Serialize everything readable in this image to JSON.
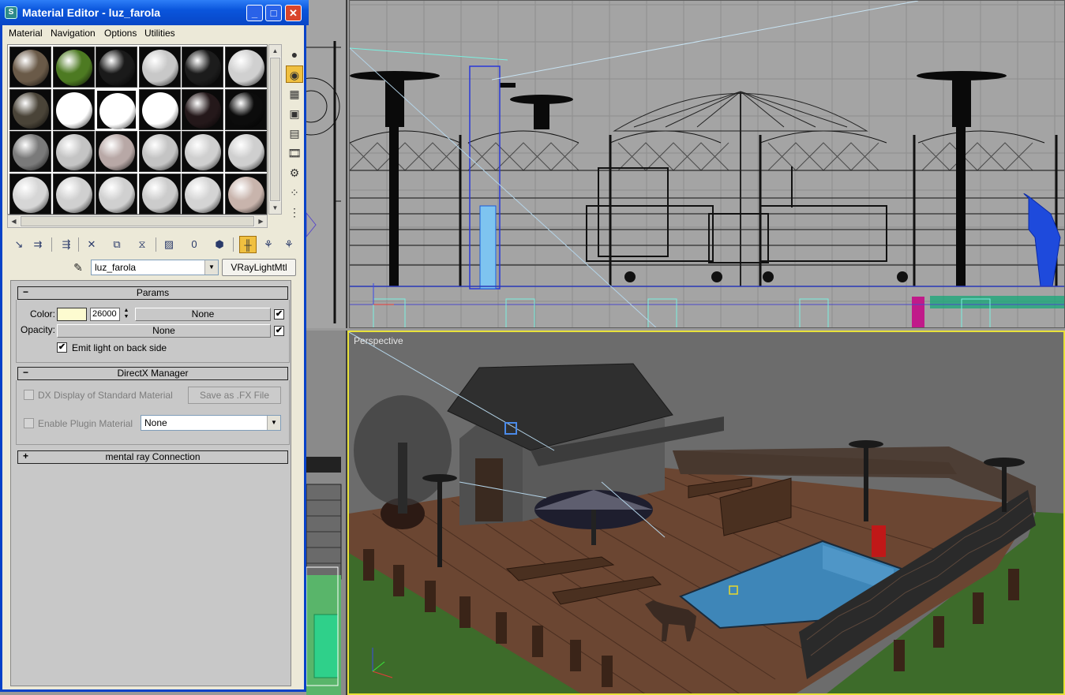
{
  "window": {
    "title": "Material Editor - luz_farola",
    "app_icon": "3ds-max-icon",
    "minimize": "_",
    "maximize": "□",
    "close": "✕"
  },
  "menu": [
    "Material",
    "Navigation",
    "Options",
    "Utilities"
  ],
  "sample_slots": [
    {
      "name": "slot-1",
      "color": "#6a5a48",
      "active": false
    },
    {
      "name": "slot-2",
      "color": "#4d7a22",
      "active": false
    },
    {
      "name": "slot-3",
      "color": "#1a1a1a",
      "active": false
    },
    {
      "name": "slot-4",
      "color": "#c8c8c8",
      "active": false
    },
    {
      "name": "slot-5",
      "color": "#1c1c1c",
      "active": false
    },
    {
      "name": "slot-6",
      "color": "#d0d0d0",
      "active": false
    },
    {
      "name": "slot-7",
      "color": "#4a4438",
      "active": false
    },
    {
      "name": "slot-8",
      "color": "#ffffff",
      "active": false
    },
    {
      "name": "slot-9",
      "color": "#ffffff",
      "active": true
    },
    {
      "name": "slot-10",
      "color": "#ffffff",
      "active": false
    },
    {
      "name": "slot-11",
      "color": "#24181a",
      "active": false
    },
    {
      "name": "slot-12",
      "color": "#0c0c0c",
      "active": false
    },
    {
      "name": "slot-13",
      "color": "#7a7a7a",
      "active": false
    },
    {
      "name": "slot-14",
      "color": "#c4c4c4",
      "active": false
    },
    {
      "name": "slot-15",
      "color": "#b8a8a6",
      "active": false
    },
    {
      "name": "slot-16",
      "color": "#c4c4c4",
      "active": false
    },
    {
      "name": "slot-17",
      "color": "#cfcfcf",
      "active": false
    },
    {
      "name": "slot-18",
      "color": "#cfcfcf",
      "active": false
    },
    {
      "name": "slot-19",
      "color": "#d6d6d6",
      "active": false
    },
    {
      "name": "slot-20",
      "color": "#d0d0d0",
      "active": false
    },
    {
      "name": "slot-21",
      "color": "#d0d0d0",
      "active": false
    },
    {
      "name": "slot-22",
      "color": "#cccccc",
      "active": false
    },
    {
      "name": "slot-23",
      "color": "#d4d4d4",
      "active": false
    },
    {
      "name": "slot-24",
      "color": "#c8b4ac",
      "active": false
    }
  ],
  "side_tools": [
    {
      "name": "sample-type-icon",
      "glyph": "●",
      "active": false
    },
    {
      "name": "backlight-icon",
      "glyph": "◉",
      "active": true
    },
    {
      "name": "background-checker-icon",
      "glyph": "▦",
      "active": false
    },
    {
      "name": "sample-uv-tiling-icon",
      "glyph": "▣",
      "active": false
    },
    {
      "name": "video-color-check-icon",
      "glyph": "▤",
      "active": false
    },
    {
      "name": "make-preview-icon",
      "glyph": "🎞",
      "active": false
    },
    {
      "name": "options-icon",
      "glyph": "⚙",
      "active": false
    },
    {
      "name": "select-by-material-icon",
      "glyph": "⁘",
      "active": false
    },
    {
      "name": "material-map-navigator-icon",
      "glyph": "⋮",
      "active": false
    }
  ],
  "bottom_tools": [
    {
      "name": "get-material-icon",
      "glyph": "↘",
      "active": false
    },
    {
      "name": "put-to-scene-icon",
      "glyph": "⇉",
      "active": false
    },
    {
      "name": "assign-to-selection-icon",
      "glyph": "⇶",
      "active": false
    },
    {
      "name": "reset-map-icon",
      "glyph": "✕",
      "active": false
    },
    {
      "name": "make-copy-icon",
      "glyph": "⧉",
      "active": false
    },
    {
      "name": "make-unique-icon",
      "glyph": "⧖",
      "active": false
    },
    {
      "name": "put-to-library-icon",
      "glyph": "▨",
      "active": false
    },
    {
      "name": "material-effects-channel-icon",
      "glyph": "0",
      "active": false
    },
    {
      "name": "show-map-in-viewport-icon",
      "glyph": "⬢",
      "active": false
    },
    {
      "name": "show-end-result-icon",
      "glyph": "╫",
      "active": true
    },
    {
      "name": "go-to-parent-icon",
      "glyph": "⚘",
      "active": false
    },
    {
      "name": "go-forward-to-sibling-icon",
      "glyph": "⚘",
      "active": false
    }
  ],
  "material": {
    "name": "luz_farola",
    "type": "VRayLightMtl",
    "picker_icon": "eyedropper-icon"
  },
  "params": {
    "header": "Params",
    "sign": "−",
    "color_label": "Color:",
    "color_value": "#fdfbd0",
    "intensity": "26000",
    "color_map": "None",
    "color_map_enabled": "✔",
    "opacity_label": "Opacity:",
    "opacity_map": "None",
    "opacity_map_enabled": "✔",
    "backside_label": "Emit light on back side",
    "backside_checked": "✔"
  },
  "directx": {
    "header": "DirectX Manager",
    "sign": "−",
    "dx_display_label": "DX Display of Standard Material",
    "save_fx_label": "Save as .FX File",
    "plugin_label": "Enable Plugin Material",
    "plugin_value": "None"
  },
  "mental_ray": {
    "header": "mental ray Connection",
    "sign": "+"
  },
  "viewports": {
    "perspective_label": "Perspective"
  }
}
